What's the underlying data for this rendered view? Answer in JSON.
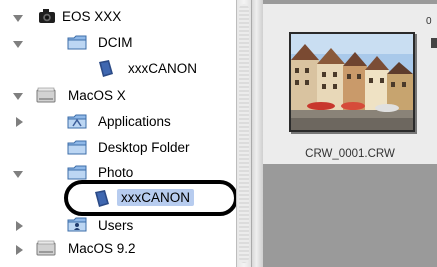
{
  "tree": {
    "items": [
      {
        "label": "EOS XXX",
        "icon": "camera-icon",
        "expanded": true
      },
      {
        "label": "DCIM",
        "icon": "folder-icon",
        "expanded": true
      },
      {
        "label": "xxxCANON",
        "icon": "canon-folder-icon"
      },
      {
        "label": "MacOS X",
        "icon": "hard-drive-icon",
        "expanded": true
      },
      {
        "label": "Applications",
        "icon": "applications-folder-icon",
        "expanded": false
      },
      {
        "label": "Desktop Folder",
        "icon": "folder-icon"
      },
      {
        "label": "Photo",
        "icon": "folder-icon",
        "expanded": true
      },
      {
        "label": "xxxCANON",
        "icon": "canon-folder-icon",
        "selected": true
      },
      {
        "label": "Users",
        "icon": "users-folder-icon",
        "expanded": false
      },
      {
        "label": "MacOS 9.2",
        "icon": "hard-drive-icon",
        "expanded": false
      }
    ]
  },
  "thumbnail": {
    "filename": "CRW_0001.CRW",
    "corner_text": "0"
  },
  "colors": {
    "selection": "#b7ccef",
    "pane_background": "#9a9a9a",
    "folder_blue": "#6d9fdc"
  }
}
